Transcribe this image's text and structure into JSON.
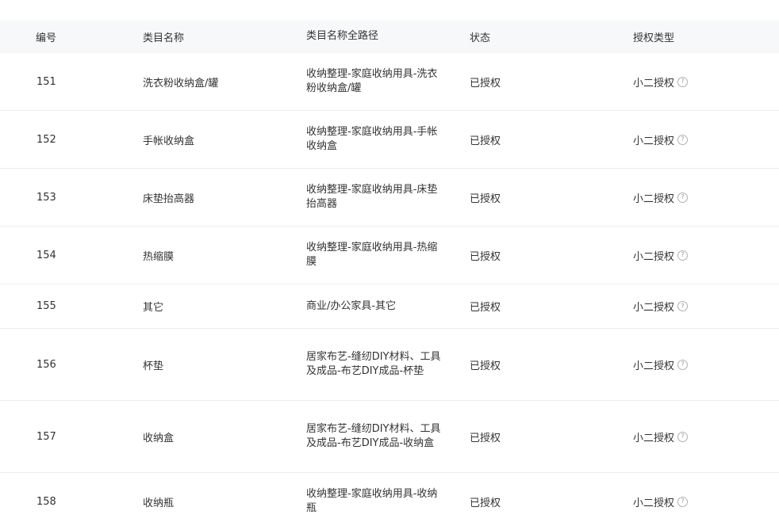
{
  "table": {
    "headers": {
      "id": "编号",
      "name": "类目名称",
      "path": "类目名称全路径",
      "status": "状态",
      "type": "授权类型"
    },
    "rows": [
      {
        "id": "151",
        "name": "洗衣粉收纳盒/罐",
        "path": "收纳整理-家庭收纳用具-洗衣粉收纳盒/罐",
        "status": "已授权",
        "type": "小二授权"
      },
      {
        "id": "152",
        "name": "手帐收纳盒",
        "path": "收纳整理-家庭收纳用具-手帐收纳盒",
        "status": "已授权",
        "type": "小二授权"
      },
      {
        "id": "153",
        "name": "床垫抬高器",
        "path": "收纳整理-家庭收纳用具-床垫抬高器",
        "status": "已授权",
        "type": "小二授权"
      },
      {
        "id": "154",
        "name": "热缩膜",
        "path": "收纳整理-家庭收纳用具-热缩膜",
        "status": "已授权",
        "type": "小二授权"
      },
      {
        "id": "155",
        "name": "其它",
        "path": "商业/办公家具-其它",
        "status": "已授权",
        "type": "小二授权"
      },
      {
        "id": "156",
        "name": "杯垫",
        "path": "居家布艺-缝纫DIY材料、工具及成品-布艺DIY成品-杯垫",
        "status": "已授权",
        "type": "小二授权"
      },
      {
        "id": "157",
        "name": "收纳盒",
        "path": "居家布艺-缝纫DIY材料、工具及成品-布艺DIY成品-收纳盒",
        "status": "已授权",
        "type": "小二授权"
      },
      {
        "id": "158",
        "name": "收纳瓶",
        "path": "收纳整理-家庭收纳用具-收纳瓶",
        "status": "已授权",
        "type": "小二授权"
      }
    ]
  },
  "icons": {
    "help_glyph": "?"
  }
}
